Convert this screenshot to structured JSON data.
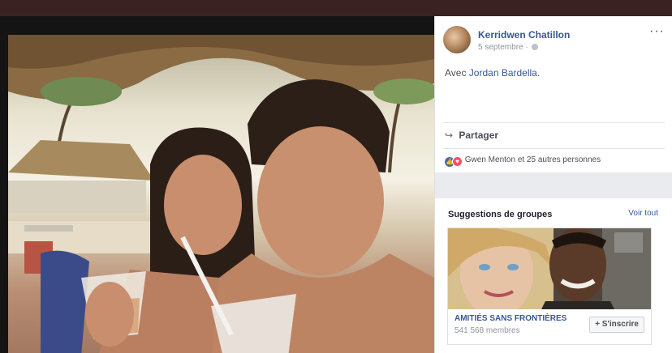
{
  "post": {
    "author": "Kerridwen Chatillon",
    "date": "5 septembre ·",
    "with_prefix": "Avec ",
    "tagged": "Jordan Bardella",
    "tagged_suffix": ".",
    "share_label": "Partager",
    "reactions_text": "Gwen Menton et 25 autres personnes"
  },
  "suggestions": {
    "title": "Suggestions de groupes",
    "see_all": "Voir tout",
    "group": {
      "name": "AMITIÉS SANS FRONTIÈRES",
      "members": "541 568 membres",
      "join_label": "+ S'inscrire"
    }
  },
  "icons": {
    "more": "more-options-icon",
    "share": "share-icon",
    "like": "like-icon",
    "love": "love-icon",
    "privacy": "globe-icon"
  },
  "colors": {
    "link": "#365899",
    "like": "#4267b2",
    "love": "#f25268"
  }
}
